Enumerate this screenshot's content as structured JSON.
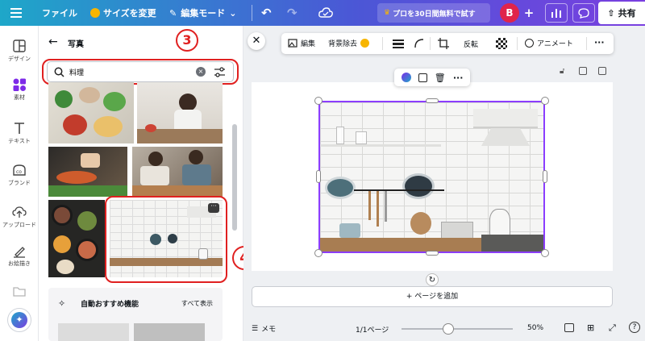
{
  "topbar": {
    "file_label": "ファイル",
    "resize_label": "サイズを変更",
    "edit_mode_label": "編集モード",
    "trial_label": "プロを30日間無料で試す",
    "avatar_letter": "B",
    "share_label": "共有"
  },
  "rail": {
    "items": [
      {
        "label": "デザイン",
        "icon": "layout-icon"
      },
      {
        "label": "素材",
        "icon": "elements-icon"
      },
      {
        "label": "テキスト",
        "icon": "text-icon"
      },
      {
        "label": "ブランド",
        "icon": "brand-icon"
      },
      {
        "label": "アップロード",
        "icon": "upload-icon"
      },
      {
        "label": "お絵描き",
        "icon": "draw-icon"
      }
    ]
  },
  "panel": {
    "title": "写真",
    "search_value": "料理",
    "feature_title": "自動おすすめ機能",
    "show_all": "すべて表示"
  },
  "annotations": {
    "step3": "3",
    "step4": "4"
  },
  "toolbar": {
    "edit": "編集",
    "bg_remove": "背景除去",
    "flip": "反転",
    "animate": "アニメート"
  },
  "canvas": {
    "add_page": "+ ページを追加"
  },
  "footer": {
    "notes": "メモ",
    "page_counter": "1/1ページ",
    "zoom": "50%"
  },
  "colors": {
    "accent": "#7d2ae8",
    "annotation": "#e02020"
  }
}
